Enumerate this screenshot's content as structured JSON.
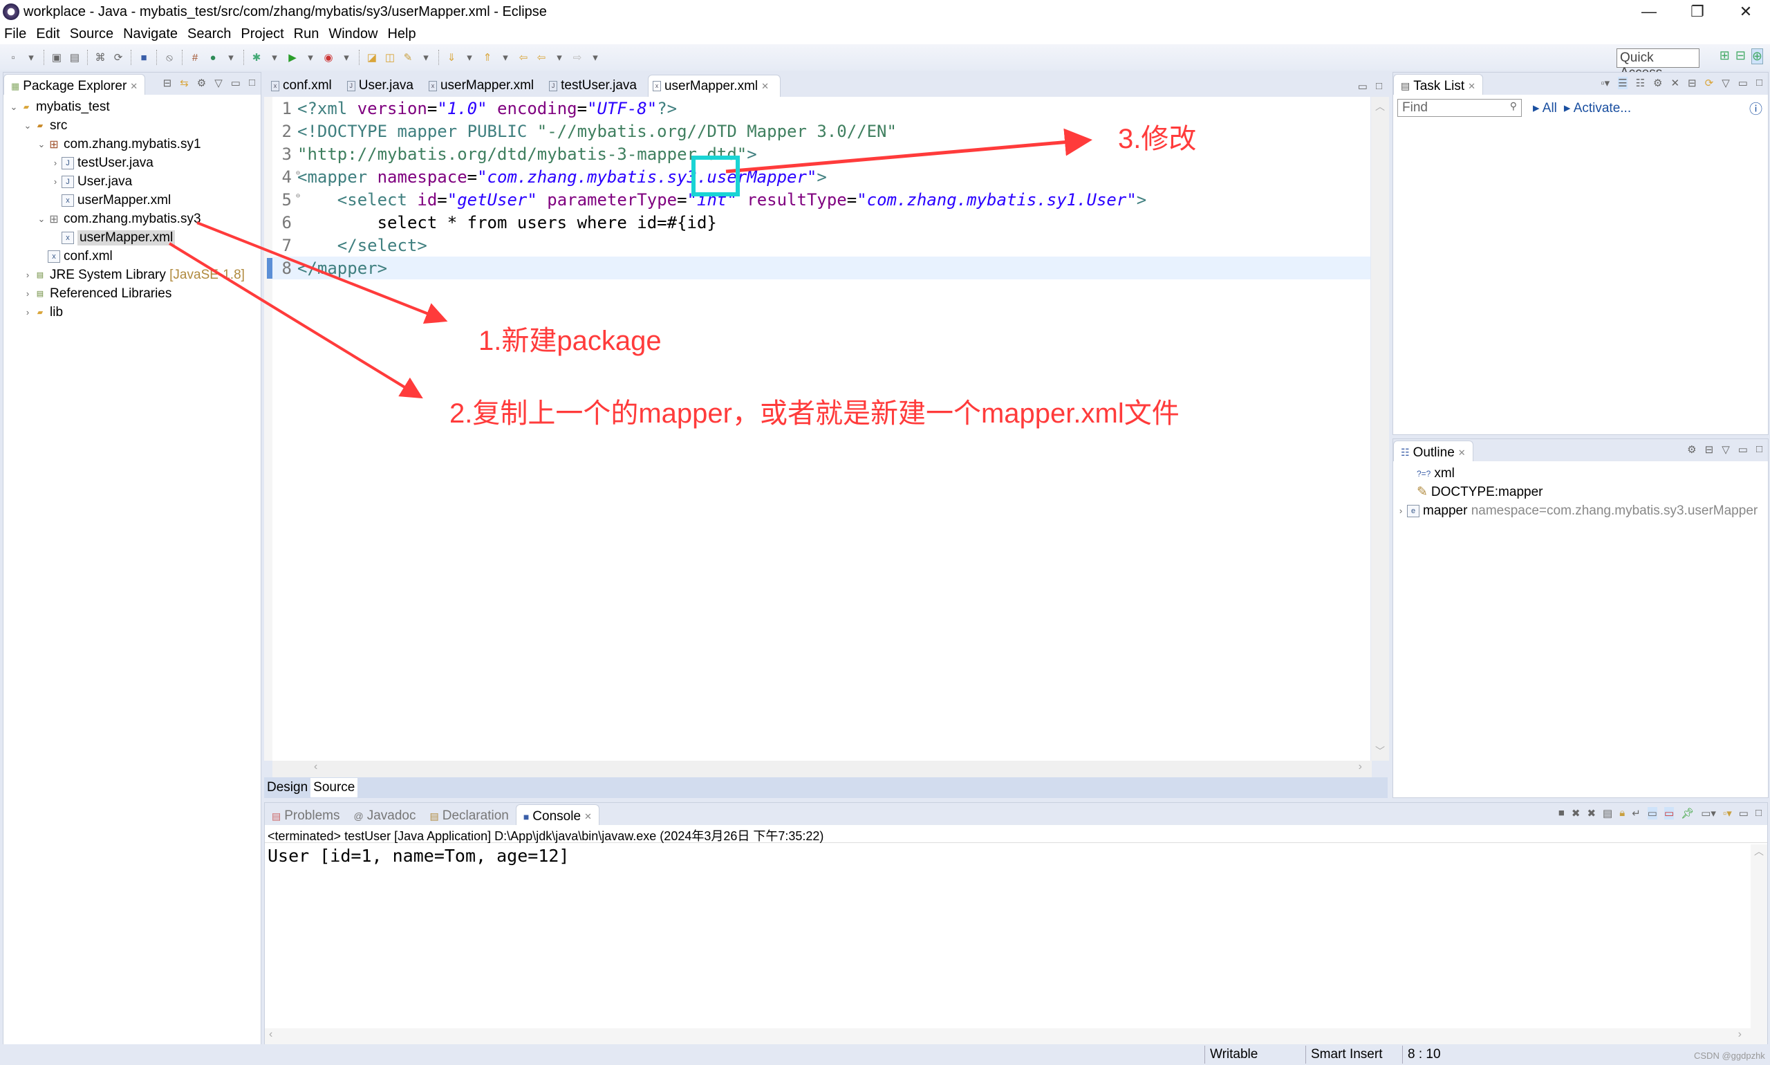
{
  "window": {
    "title": "workplace - Java - mybatis_test/src/com/zhang/mybatis/sy3/userMapper.xml - Eclipse",
    "minimize": "—",
    "maximize": "❐",
    "close": "✕"
  },
  "menu": [
    "File",
    "Edit",
    "Source",
    "Navigate",
    "Search",
    "Project",
    "Run",
    "Window",
    "Help"
  ],
  "toolbar": {
    "quick_access": "Quick Access"
  },
  "package_explorer": {
    "title": "Package Explorer",
    "items": [
      {
        "label": "mybatis_test",
        "icon": "project-icon",
        "toggle": "⌄"
      },
      {
        "label": "src",
        "icon": "source-folder-icon",
        "toggle": "⌄"
      },
      {
        "label": "com.zhang.mybatis.sy1",
        "icon": "package-icon",
        "toggle": "⌄"
      },
      {
        "label": "testUser.java",
        "icon": "java-file-icon",
        "toggle": "›"
      },
      {
        "label": "User.java",
        "icon": "java-file-icon",
        "toggle": "›"
      },
      {
        "label": "userMapper.xml",
        "icon": "xml-file-icon",
        "toggle": ""
      },
      {
        "label": "com.zhang.mybatis.sy3",
        "icon": "package-icon",
        "toggle": "⌄"
      },
      {
        "label": "userMapper.xml",
        "icon": "xml-file-icon",
        "toggle": "",
        "selected": true
      },
      {
        "label": "conf.xml",
        "icon": "xml-file-icon",
        "toggle": ""
      },
      {
        "label": "JRE System Library",
        "suffix": "[JavaSE-1.8]",
        "icon": "library-icon",
        "toggle": "›"
      },
      {
        "label": "Referenced Libraries",
        "icon": "library-icon",
        "toggle": "›"
      },
      {
        "label": "lib",
        "icon": "folder-icon",
        "toggle": "›"
      }
    ]
  },
  "editor": {
    "tabs": [
      "conf.xml",
      "User.java",
      "userMapper.xml",
      "testUser.java",
      "userMapper.xml"
    ],
    "active_tab": 4,
    "line_numbers": [
      "1",
      "2",
      "3",
      "4",
      "5",
      "6",
      "7",
      "8"
    ],
    "lines": {
      "l1": [
        "<?xml ",
        "version",
        "=",
        "\"1.0\"",
        " encoding",
        "=",
        "\"UTF-8\"",
        "?>"
      ],
      "l2": [
        "<!DOCTYPE mapper PUBLIC ",
        "\"-//mybatis.org//DTD Mapper 3.0//EN\""
      ],
      "l3": [
        "\"http://mybatis.org/dtd/mybatis-3-mapper.dtd\"",
        ">"
      ],
      "l4": [
        "<mapper ",
        "namespace",
        "=",
        "\"com.zhang.mybatis.sy3.userMapper\"",
        ">"
      ],
      "l5": [
        "    <select ",
        "id",
        "=",
        "\"getUser\"",
        " parameterType",
        "=",
        "\"int\"",
        " resultType",
        "=",
        "\"com.zhang.mybatis.sy1.User\"",
        ">"
      ],
      "l6": "        select * from users where id=#{id}",
      "l7": "    </select>",
      "l8": "</mapper>"
    },
    "bottom_tabs": [
      "Design",
      "Source"
    ],
    "active_bottom_tab": "Source"
  },
  "task_list": {
    "title": "Task List",
    "find_placeholder": "Find",
    "all": "All",
    "activate": "Activate..."
  },
  "outline": {
    "title": "Outline",
    "items": [
      {
        "label": "xml",
        "icon": "pi-icon"
      },
      {
        "label": "DOCTYPE:mapper",
        "icon": "doctype-icon"
      },
      {
        "label": "mapper",
        "detail": "namespace=com.zhang.mybatis.sy3.userMapper",
        "icon": "element-icon"
      }
    ]
  },
  "console": {
    "tabs": [
      "Problems",
      "Javadoc",
      "Declaration",
      "Console"
    ],
    "active_tab": "Console",
    "info": "<terminated> testUser [Java Application] D:\\App\\jdk\\java\\bin\\javaw.exe (2024年3月26日 下午7:35:22)",
    "output": "User [id=1, name=Tom, age=12]"
  },
  "status": {
    "writable": "Writable",
    "insert_mode": "Smart Insert",
    "position": "8 : 10",
    "watermark": "CSDN @ggdpzhk"
  },
  "annotations": {
    "step1": "1.新建package",
    "step2": "2.复制上一个的mapper，或者就是新建一个mapper.xml文件",
    "step3": "3.修改",
    "color": "#ff3b3b",
    "highlight_color": "#1ad4d4"
  }
}
